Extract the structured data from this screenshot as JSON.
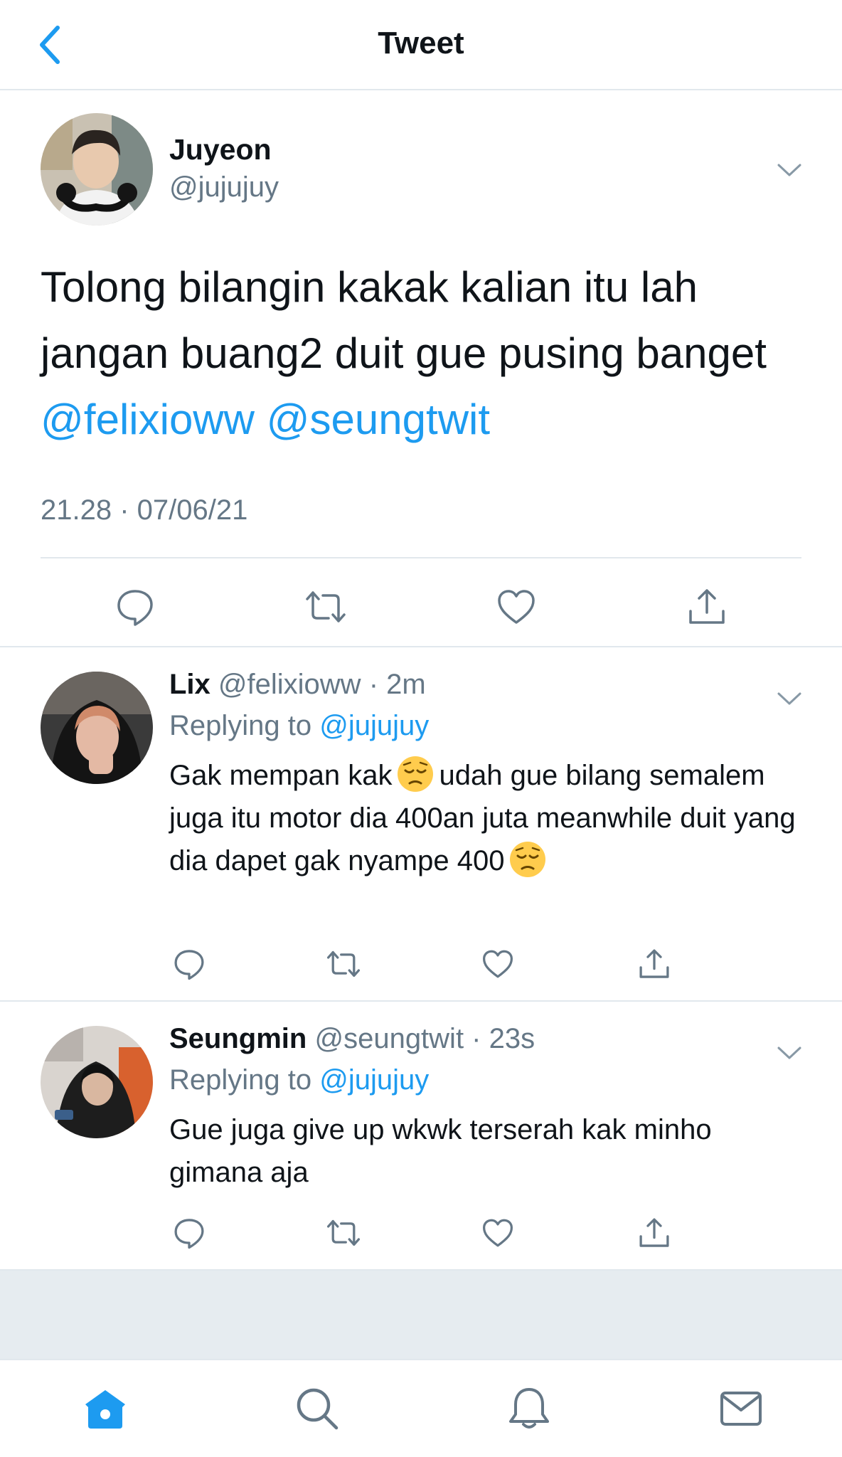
{
  "header": {
    "title": "Tweet",
    "back_icon": "chevron-left-icon"
  },
  "colors": {
    "accent": "#1d9bf0",
    "secondary_text": "#657786",
    "divider": "#e1e8ed",
    "filler": "#e6ecf0",
    "home_active": "#1d9bf0"
  },
  "main_tweet": {
    "author_name": "Juyeon",
    "author_handle": "@jujujuy",
    "text_plain": "Tolong bilangin kakak kalian itu lah jangan buang2 duit gue pusing banget",
    "mention_1": "@felixioww",
    "mention_2": "@seungtwit",
    "timestamp": "21.28 · 07/06/21",
    "actions": [
      "reply-icon",
      "retweet-icon",
      "like-icon",
      "share-icon"
    ]
  },
  "replies": [
    {
      "name": "Lix",
      "handle": "@felixioww",
      "meta_sep": " · ",
      "time": "2m",
      "replying_prefix": "Replying to",
      "replying_handle": "@jujujuy",
      "text_part_1": "Gak mempan kak",
      "text_part_2": "udah gue bilang semalem juga itu motor dia 400an juta meanwhile duit yang dia dapet gak nyampe 400",
      "emoji": "pensive-face-emoji"
    },
    {
      "name": "Seungmin",
      "handle": "@seungtwit",
      "meta_sep": " · ",
      "time": "23s",
      "replying_prefix": "Replying to",
      "replying_handle": "@jujujuy",
      "text": "Gue juga give up wkwk terserah kak minho gimana aja"
    }
  ],
  "tabbar": {
    "items": [
      "home-icon",
      "search-icon",
      "notifications-icon",
      "messages-icon"
    ],
    "active": "home-icon"
  }
}
